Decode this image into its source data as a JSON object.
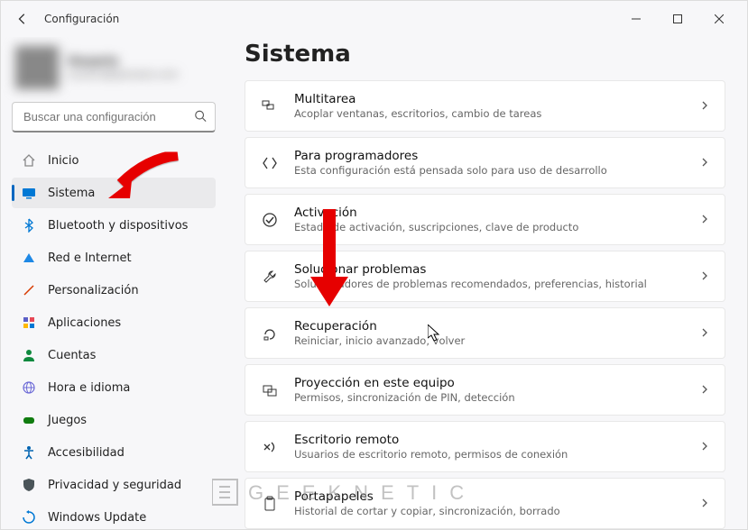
{
  "window": {
    "title": "Configuración"
  },
  "profile": {
    "name": "Usuario",
    "email": "usuario@ejemplo.com"
  },
  "search": {
    "placeholder": "Buscar una configuración"
  },
  "sidebar": {
    "items": [
      {
        "id": "inicio",
        "label": "Inicio",
        "icon": "home",
        "color": "#888"
      },
      {
        "id": "sistema",
        "label": "Sistema",
        "icon": "display",
        "color": "#0078d4",
        "selected": true
      },
      {
        "id": "bluetooth",
        "label": "Bluetooth y dispositivos",
        "icon": "bluetooth",
        "color": "#0078d4"
      },
      {
        "id": "red",
        "label": "Red e Internet",
        "icon": "wifi",
        "color": "#1e88e5"
      },
      {
        "id": "personalizacion",
        "label": "Personalización",
        "icon": "brush",
        "color": "#d83b01"
      },
      {
        "id": "aplicaciones",
        "label": "Aplicaciones",
        "icon": "apps",
        "color": "#5b5fc7"
      },
      {
        "id": "cuentas",
        "label": "Cuentas",
        "icon": "person",
        "color": "#10893e"
      },
      {
        "id": "hora",
        "label": "Hora e idioma",
        "icon": "globe",
        "color": "#6b69d6"
      },
      {
        "id": "juegos",
        "label": "Juegos",
        "icon": "gamepad",
        "color": "#107c10"
      },
      {
        "id": "accesibilidad",
        "label": "Accesibilidad",
        "icon": "accessibility",
        "color": "#0063b1"
      },
      {
        "id": "privacidad",
        "label": "Privacidad y seguridad",
        "icon": "shield",
        "color": "#4a5459"
      },
      {
        "id": "update",
        "label": "Windows Update",
        "icon": "update",
        "color": "#0078d4"
      }
    ]
  },
  "main": {
    "title": "Sistema",
    "cards": [
      {
        "id": "multitarea",
        "title": "Multitarea",
        "desc": "Acoplar ventanas, escritorios, cambio de tareas",
        "icon": "windows"
      },
      {
        "id": "programadores",
        "title": "Para programadores",
        "desc": "Esta configuración está pensada solo para uso de desarrollo",
        "icon": "devtools"
      },
      {
        "id": "activacion",
        "title": "Activación",
        "desc": "Estado de activación, suscripciones, clave de producto",
        "icon": "check"
      },
      {
        "id": "problemas",
        "title": "Solucionar problemas",
        "desc": "Solucionadores de problemas recomendados, preferencias, historial",
        "icon": "wrench"
      },
      {
        "id": "recuperacion",
        "title": "Recuperación",
        "desc": "Reiniciar, inicio avanzado, volver",
        "icon": "recovery"
      },
      {
        "id": "proyeccion",
        "title": "Proyección en este equipo",
        "desc": "Permisos, sincronización de PIN, detección",
        "icon": "project"
      },
      {
        "id": "remoto",
        "title": "Escritorio remoto",
        "desc": "Usuarios de escritorio remoto, permisos de conexión",
        "icon": "remote"
      },
      {
        "id": "portapapeles",
        "title": "Portapapeles",
        "desc": "Historial de cortar y copiar, sincronización, borrado",
        "icon": "clipboard"
      }
    ]
  },
  "watermark_text": "GEEKNETIC",
  "annotations": {
    "arrow1_target": "sistema",
    "arrow2_target": "recuperacion"
  }
}
